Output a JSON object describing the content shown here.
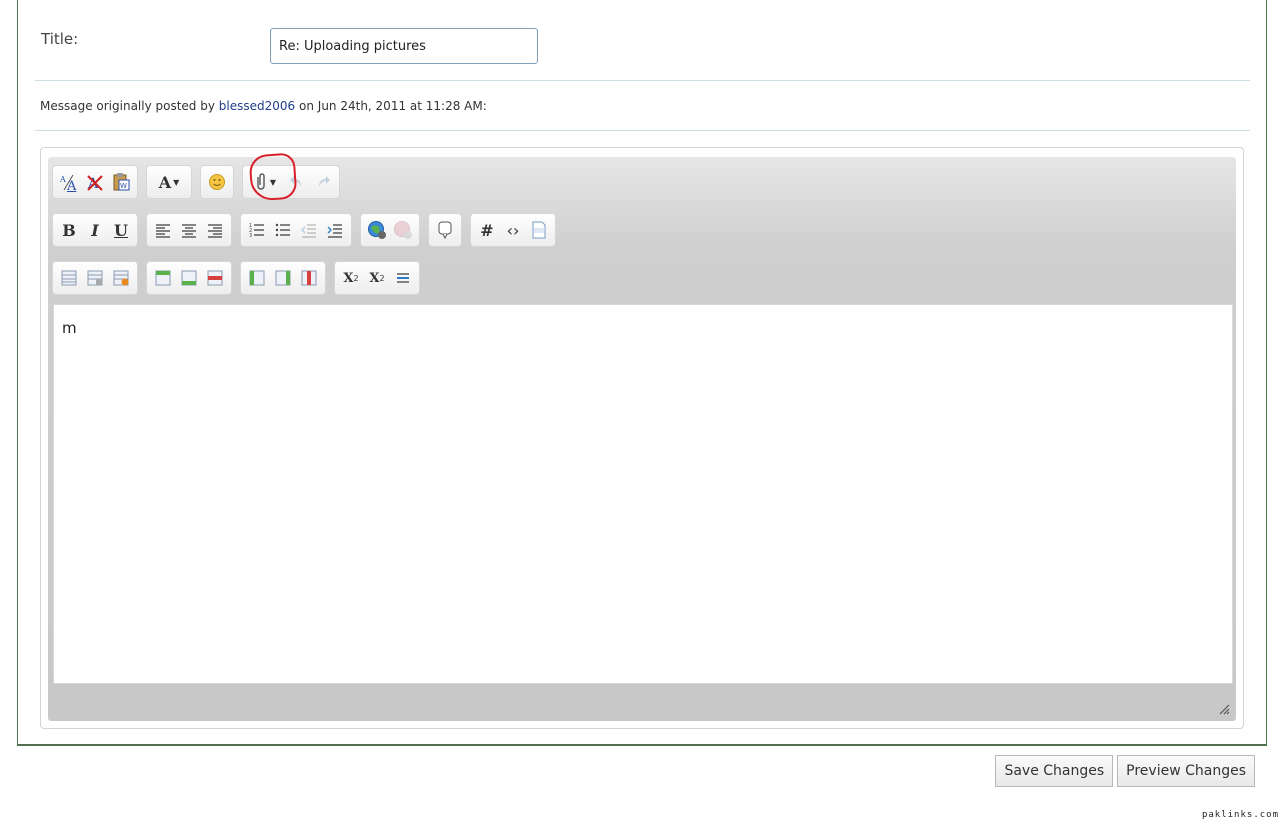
{
  "form": {
    "title_label": "Title:",
    "title_value": "Re: Uploading pictures",
    "original_prefix": "Message originally posted by",
    "original_user": "blessed2006",
    "original_suffix": "on Jun 24th, 2011 at 11:28 AM:"
  },
  "toolbar": {
    "hash_glyph": "#",
    "code_glyph": "‹›",
    "bold_label": "B",
    "italic_label": "I",
    "underline_label": "U",
    "font_label": "A",
    "sub_label": "X",
    "sup_label": "X",
    "sub_mark": "2",
    "sup_mark": "2",
    "highlight_color": "#d8202a"
  },
  "editor": {
    "content": "m"
  },
  "buttons": {
    "save": "Save Changes",
    "preview": "Preview Changes"
  },
  "watermark": "paklinks.com"
}
